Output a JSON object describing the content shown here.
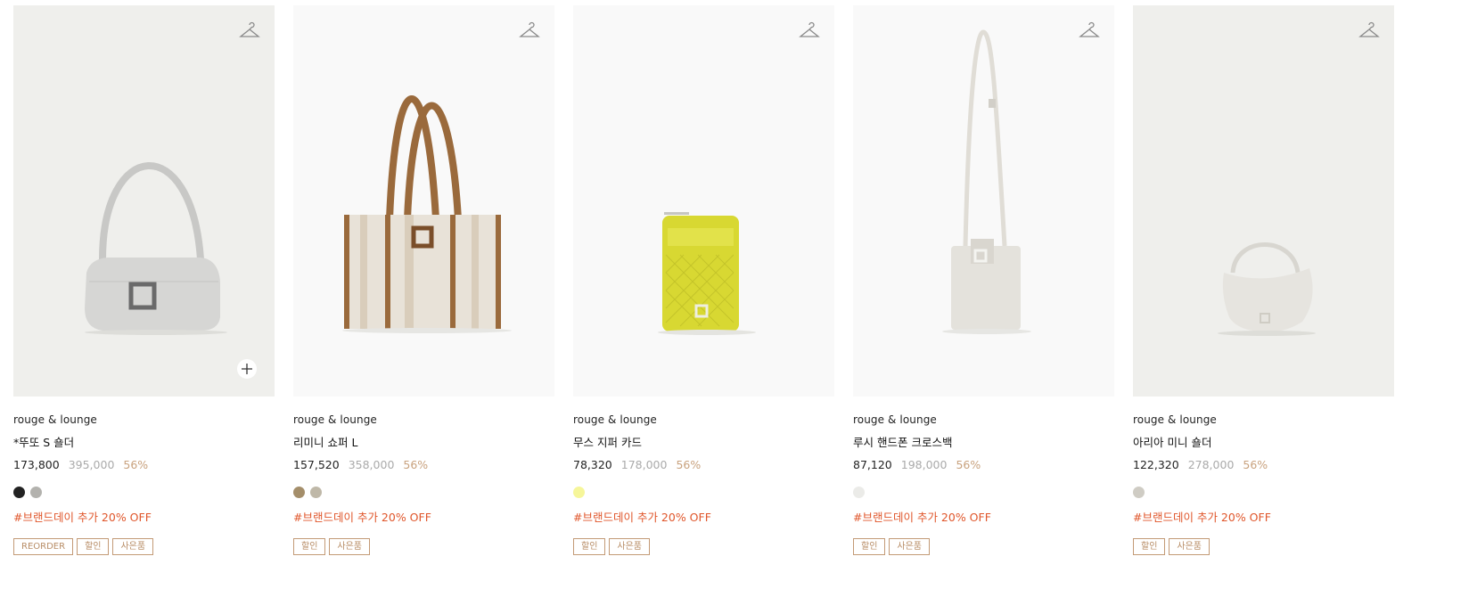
{
  "colors": {
    "accent_tan": "#c39a76",
    "promo_red": "#e0562b",
    "discount": "#c9a27e"
  },
  "products": [
    {
      "brand": "rouge & lounge",
      "name": "*뚜또 S 숄더",
      "sale_price": "173,800",
      "original_price": "395,000",
      "discount": "56%",
      "background": "#efefec",
      "swatches": [
        "#222222",
        "#b3b2ae"
      ],
      "promo": "#브랜드데이 추가 20% OFF",
      "badges": [
        "REORDER",
        "할인",
        "사은품"
      ],
      "has_plus": true
    },
    {
      "brand": "rouge & lounge",
      "name": "리미니 쇼퍼 L",
      "sale_price": "157,520",
      "original_price": "358,000",
      "discount": "56%",
      "background": "#f9f9f9",
      "swatches": [
        "#a48e6a",
        "#bfb8a8"
      ],
      "promo": "#브랜드데이 추가 20% OFF",
      "badges": [
        "할인",
        "사은품"
      ],
      "has_plus": false
    },
    {
      "brand": "rouge & lounge",
      "name": "무스 지퍼 카드",
      "sale_price": "78,320",
      "original_price": "178,000",
      "discount": "56%",
      "background": "#f9f9f9",
      "swatches": [
        "#f6f69a"
      ],
      "promo": "#브랜드데이 추가 20% OFF",
      "badges": [
        "할인",
        "사은품"
      ],
      "has_plus": false
    },
    {
      "brand": "rouge & lounge",
      "name": "루시 핸드폰 크로스백",
      "sale_price": "87,120",
      "original_price": "198,000",
      "discount": "56%",
      "background": "#f9f9f9",
      "swatches": [
        "#ebebe8"
      ],
      "promo": "#브랜드데이 추가 20% OFF",
      "badges": [
        "할인",
        "사은품"
      ],
      "has_plus": false
    },
    {
      "brand": "rouge & lounge",
      "name": "아리아 미니 숄더",
      "sale_price": "122,320",
      "original_price": "278,000",
      "discount": "56%",
      "background": "#efefec",
      "swatches": [
        "#cfccc4"
      ],
      "promo": "#브랜드데이 추가 20% OFF",
      "badges": [
        "할인",
        "사은품"
      ],
      "has_plus": false
    }
  ]
}
